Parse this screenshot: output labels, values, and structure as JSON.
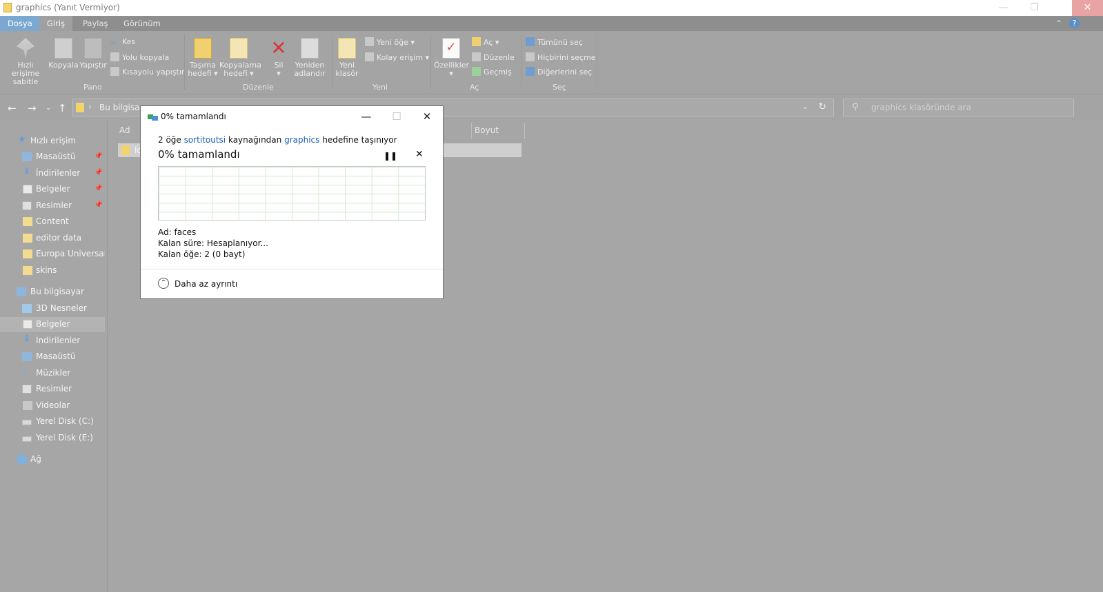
{
  "window": {
    "title": "graphics (Yanıt Vermiyor)",
    "controls": [
      "—",
      "❐",
      "✕"
    ]
  },
  "ribbon_tabs": [
    "Dosya",
    "Giriş",
    "Paylaş",
    "Görünüm"
  ],
  "ribbon": {
    "pano": {
      "label": "Pano",
      "pin": "Hızlı erişime sabitle",
      "copy": "Kopyala",
      "paste": "Yapıştır",
      "cut": "Kes",
      "copy_path": "Yolu kopyala",
      "paste_shortcut": "Kısayolu yapıştır"
    },
    "duzenle": {
      "label": "Düzenle",
      "move_to": "Taşıma hedefi",
      "copy_to": "Kopyalama hedefi",
      "delete": "Sil",
      "rename": "Yeniden adlandır"
    },
    "yeni": {
      "label": "Yeni",
      "new_folder": "Yeni klasör",
      "new_item": "Yeni öğe",
      "easy_access": "Kolay erişim"
    },
    "ac": {
      "label": "Aç",
      "properties": "Özellikler",
      "open": "Aç",
      "edit": "Düzenle",
      "history": "Geçmiş"
    },
    "sec": {
      "label": "Seç",
      "select_all": "Tümünü seç",
      "select_none": "Hiçbirini seçme",
      "invert": "Diğerlerini seç"
    }
  },
  "address": {
    "path": "Bu bilgisayar",
    "search_placeholder": "graphics klasöründe ara"
  },
  "sidebar": {
    "quick_access": "Hızlı erişim",
    "quick_items": [
      "Masaüstü",
      "İndirilenler",
      "Belgeler",
      "Resimler",
      "Content",
      "editor data",
      "Europa Universalis I",
      "skins"
    ],
    "this_pc": "Bu bilgisayar",
    "pc_items": [
      "3D Nesneler",
      "Belgeler",
      "İndirilenler",
      "Masaüstü",
      "Müzikler",
      "Resimler",
      "Videolar",
      "Yerel Disk (C:)",
      "Yerel Disk (E:)"
    ],
    "network": "Ağ"
  },
  "content": {
    "col_name": "Ad",
    "col_size": "Boyut",
    "file_name": "lo"
  },
  "dialog": {
    "title": "0% tamamlandı",
    "count": "2 öğe",
    "source": "sortitoutsi",
    "source_suffix": "kaynağından",
    "dest": "graphics",
    "dest_suffix": "hedefine taşınıyor",
    "progress_text": "0%  tamamlandı",
    "progress": 0,
    "name_label": "Ad:",
    "name_value": "faces",
    "time_label": "Kalan süre:",
    "time_value": "Hesaplanıyor...",
    "items_label": "Kalan öğe:",
    "items_value": "2 (0 bayt)",
    "less_details": "Daha az ayrıntı"
  }
}
